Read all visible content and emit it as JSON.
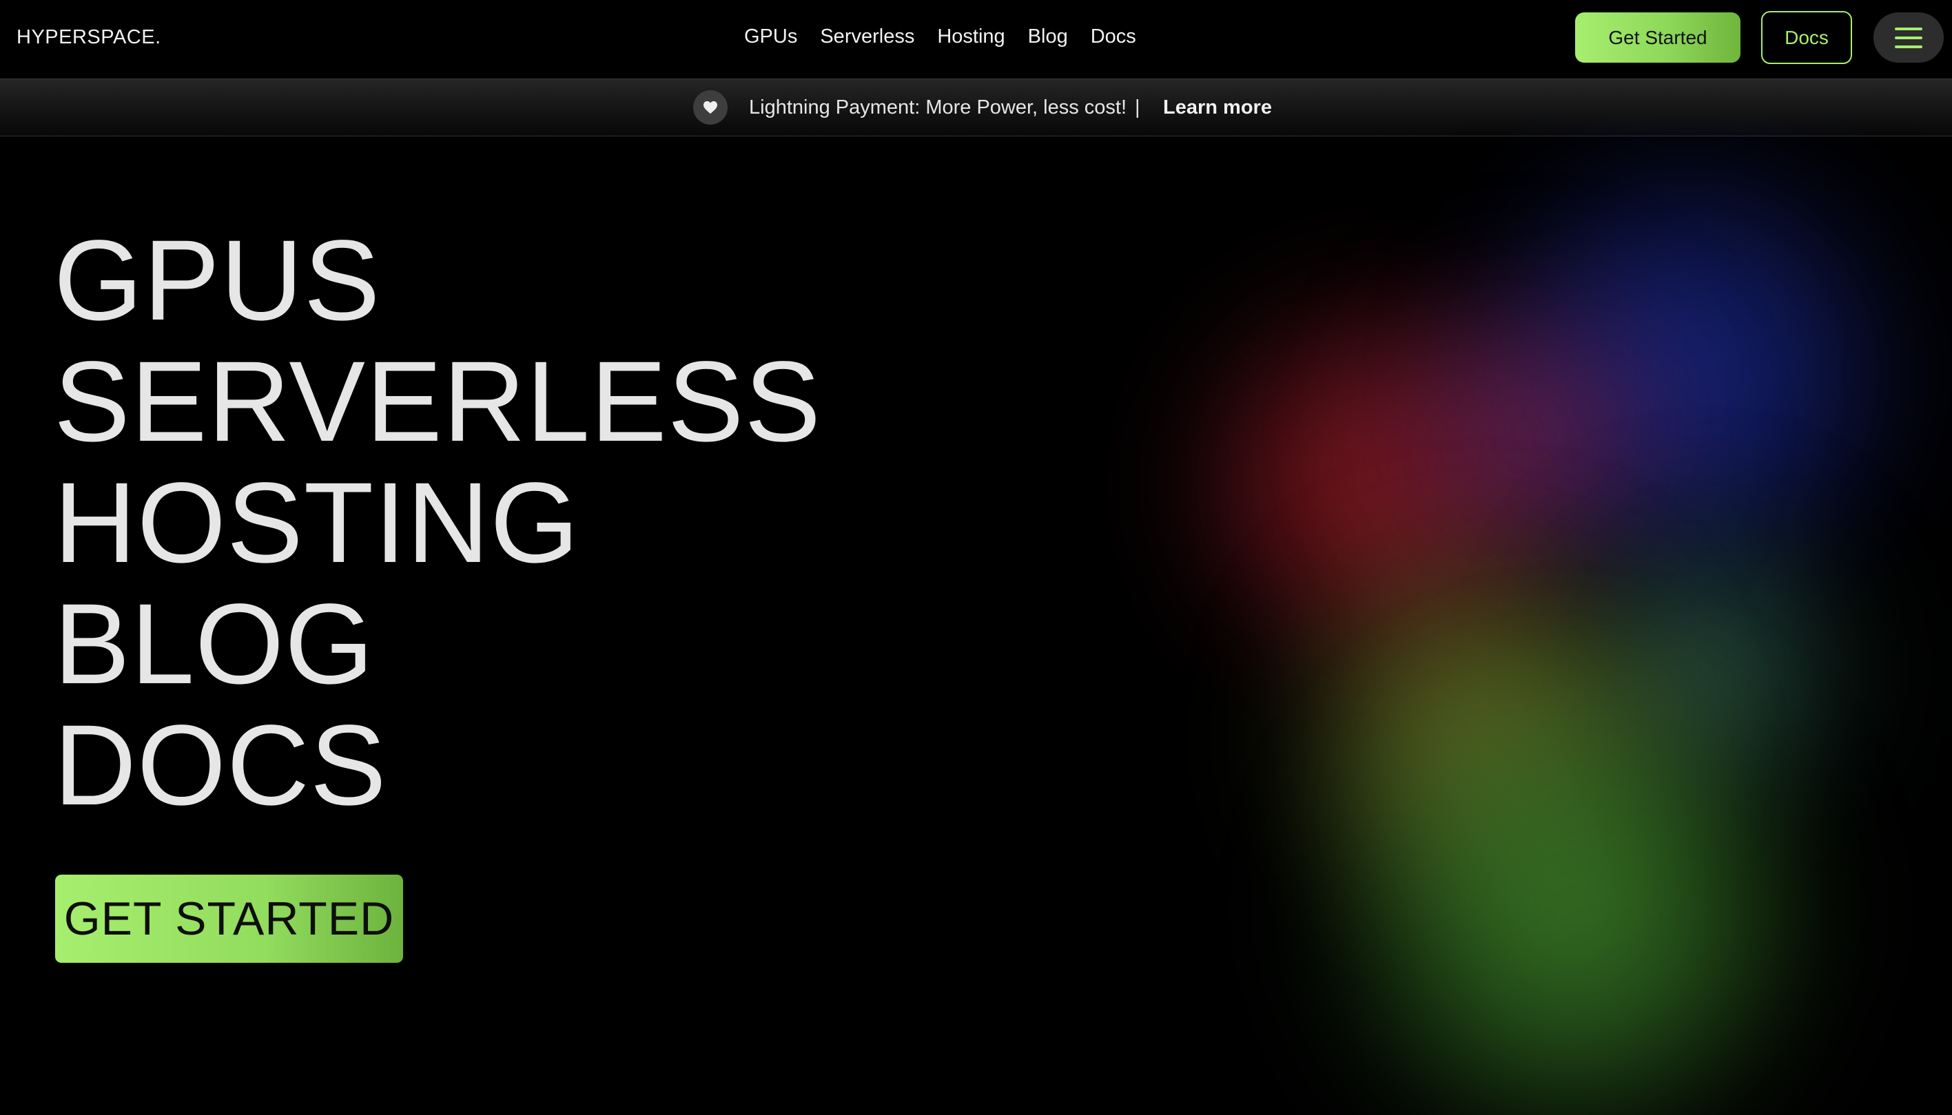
{
  "header": {
    "logo": "HYPERSPACE.",
    "nav": [
      "GPUs",
      "Serverless",
      "Hosting",
      "Blog",
      "Docs"
    ],
    "get_started_label": "Get Started",
    "docs_label": "Docs",
    "menu_icon": "hamburger-menu-icon"
  },
  "announcement": {
    "icon": "heart-icon",
    "text": "Lightning Payment: More Power, less cost!",
    "separator": "|",
    "link": "Learn more"
  },
  "hero": {
    "items": [
      "GPUS",
      "SERVERLESS",
      "HOSTING",
      "BLOG",
      "DOCS"
    ],
    "cta_label": "GET STARTED"
  },
  "colors": {
    "accent": "#a6ee6e",
    "background": "#000000",
    "text": "#e6e6e6"
  }
}
